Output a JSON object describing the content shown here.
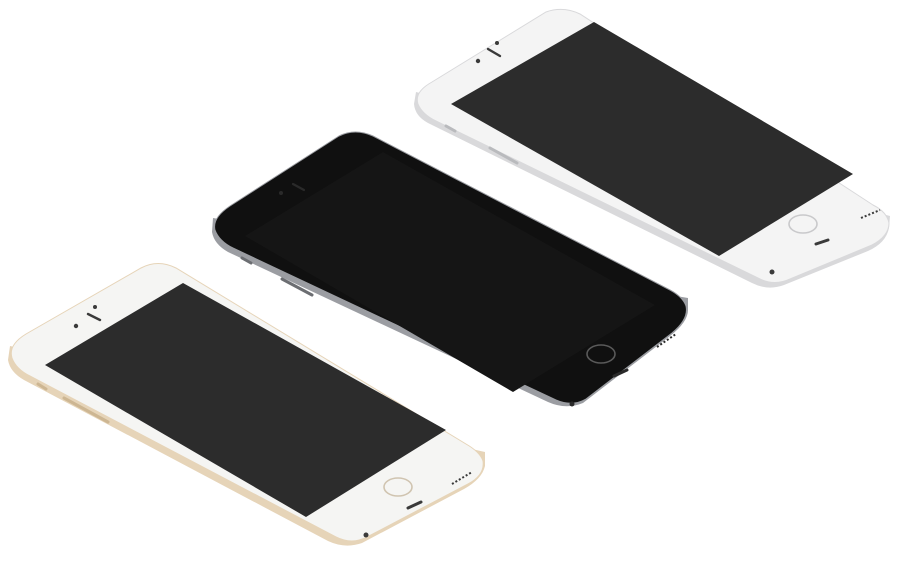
{
  "scene": {
    "background": "#ffffff",
    "phones": [
      {
        "id": "silver",
        "finish": "silver",
        "colors": {
          "face": "#f4f4f4",
          "edge": "#d9d9db",
          "edge_dark": "#b9babd",
          "screen": "#2c2c2c",
          "home_ring": "#c9c9cb",
          "slot": "#3a3a3a"
        }
      },
      {
        "id": "space-gray",
        "finish": "space gray",
        "colors": {
          "face": "#101010",
          "edge": "#9b9da2",
          "edge_dark": "#6c6e72",
          "screen": "#151515",
          "home_ring": "#5a5a5a",
          "slot": "#2a2a2a"
        }
      },
      {
        "id": "gold",
        "finish": "gold",
        "colors": {
          "face": "#f5f5f3",
          "edge": "#e6d4b8",
          "edge_dark": "#cdb692",
          "screen": "#2c2c2c",
          "home_ring": "#d0c4b0",
          "slot": "#3a3a3a"
        }
      }
    ]
  }
}
